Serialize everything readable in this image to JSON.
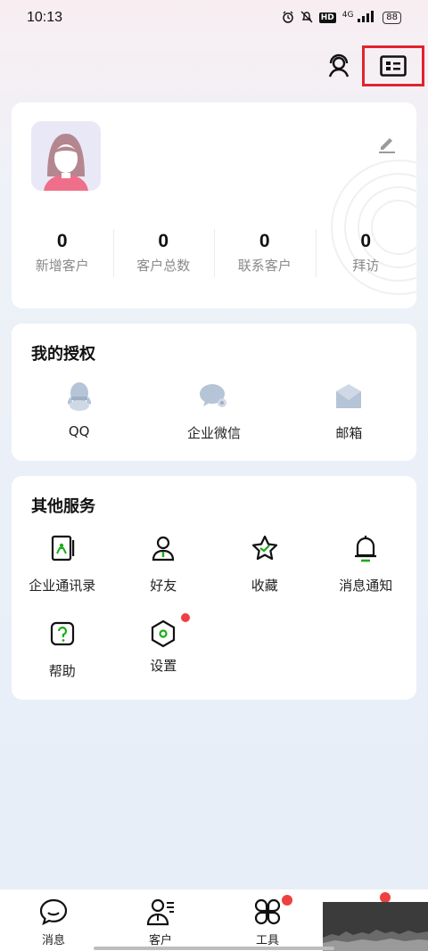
{
  "status_bar": {
    "time": "10:13",
    "hd_label": "HD",
    "network": "4G",
    "battery": "88"
  },
  "topbar": {
    "service_icon": "customer-service-icon",
    "card_icon": "business-card-icon"
  },
  "profile": {
    "avatar_icon": "avatar-female",
    "edit_icon": "pencil-icon",
    "stats": [
      {
        "value": "0",
        "label": "新增客户"
      },
      {
        "value": "0",
        "label": "客户总数"
      },
      {
        "value": "0",
        "label": "联系客户"
      },
      {
        "value": "0",
        "label": "拜访"
      }
    ]
  },
  "authorization": {
    "title": "我的授权",
    "items": [
      {
        "label": "QQ",
        "icon": "qq-icon"
      },
      {
        "label": "企业微信",
        "icon": "wecom-icon"
      },
      {
        "label": "邮箱",
        "icon": "mail-icon"
      }
    ]
  },
  "other_services": {
    "title": "其他服务",
    "items": [
      {
        "label": "企业通讯录",
        "icon": "contacts-book-icon"
      },
      {
        "label": "好友",
        "icon": "friend-icon"
      },
      {
        "label": "收藏",
        "icon": "star-icon"
      },
      {
        "label": "消息通知",
        "icon": "bell-icon"
      },
      {
        "label": "帮助",
        "icon": "help-icon"
      },
      {
        "label": "设置",
        "icon": "settings-icon",
        "badge": true
      }
    ]
  },
  "tabbar": {
    "tabs": [
      {
        "label": "消息",
        "icon": "message-icon"
      },
      {
        "label": "客户",
        "icon": "customer-icon"
      },
      {
        "label": "工具",
        "icon": "tools-icon",
        "badge": true
      },
      {
        "label": "",
        "icon": "me-icon",
        "badge": true
      }
    ]
  },
  "colors": {
    "accent_green": "#1aad19",
    "badge_red": "#ef4040",
    "highlight_red": "#e2232f"
  }
}
